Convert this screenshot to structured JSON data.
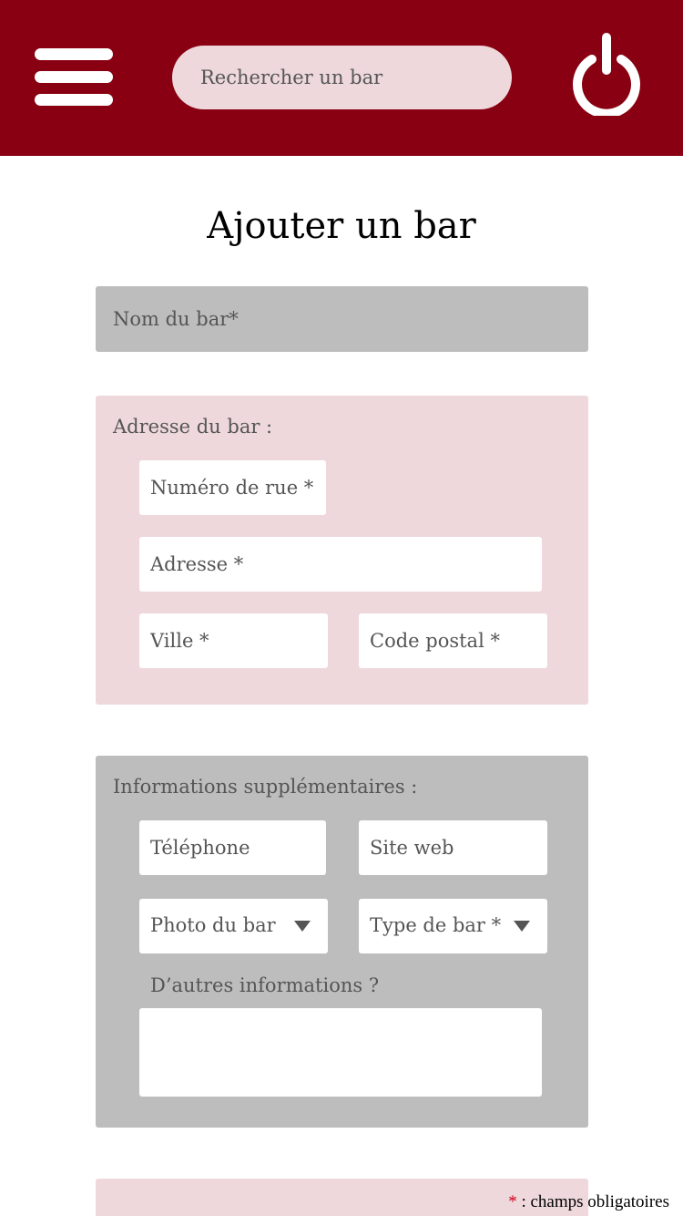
{
  "header": {
    "search_placeholder": "Rechercher un bar",
    "background_color": "#880011",
    "menu_icon": "hamburger-menu-icon",
    "power_icon": "power-icon"
  },
  "page": {
    "title": "Ajouter un bar"
  },
  "form": {
    "name_placeholder": "Nom du bar*",
    "address": {
      "label": "Adresse du bar :",
      "street_number_placeholder": "Numéro de rue *",
      "address_placeholder": "Adresse *",
      "city_placeholder": "Ville *",
      "postal_code_placeholder": "Code postal *"
    },
    "extra": {
      "label": "Informations supplémentaires :",
      "phone_placeholder": "Téléphone",
      "website_placeholder": "Site web",
      "photo_select": "Photo du bar",
      "type_select": "Type de bar *",
      "other_label": "D’autres informations ?",
      "other_value": ""
    }
  },
  "footer": {
    "legend_star": "*",
    "legend_text": " : champs obligatoires"
  },
  "colors": {
    "accent": "#880011",
    "pink": "#eed8dc",
    "grey": "#bdbdbd",
    "required_star": "#d0021b"
  }
}
